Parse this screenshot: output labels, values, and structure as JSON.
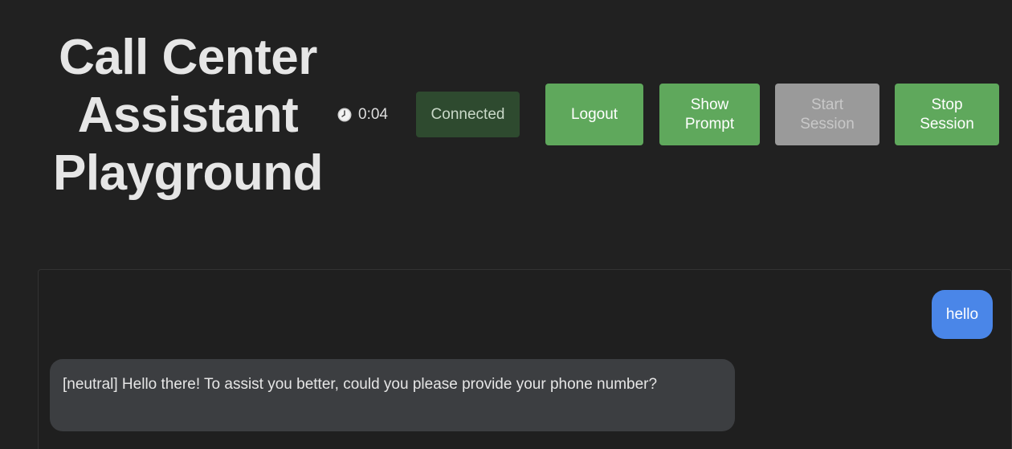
{
  "header": {
    "title": "Call Center Assistant Playground"
  },
  "timer": {
    "icon": "clock-icon",
    "value": "0:04"
  },
  "status": {
    "label": "Connected",
    "color": "#2e4a2f"
  },
  "toolbar": {
    "logout_label": "Logout",
    "show_prompt_label": "Show Prompt",
    "start_session_label": "Start Session",
    "stop_session_label": "Stop Session",
    "start_session_disabled": true
  },
  "colors": {
    "background": "#212121",
    "button_green": "#5fa85c",
    "button_disabled": "#9a9a9a",
    "user_bubble": "#4a86e8",
    "assistant_bubble": "#3c3e41"
  },
  "chat": {
    "messages": [
      {
        "role": "user",
        "text": "hello"
      },
      {
        "role": "assistant",
        "text": "[neutral] Hello there! To assist you better, could you please provide your phone number?"
      }
    ]
  }
}
